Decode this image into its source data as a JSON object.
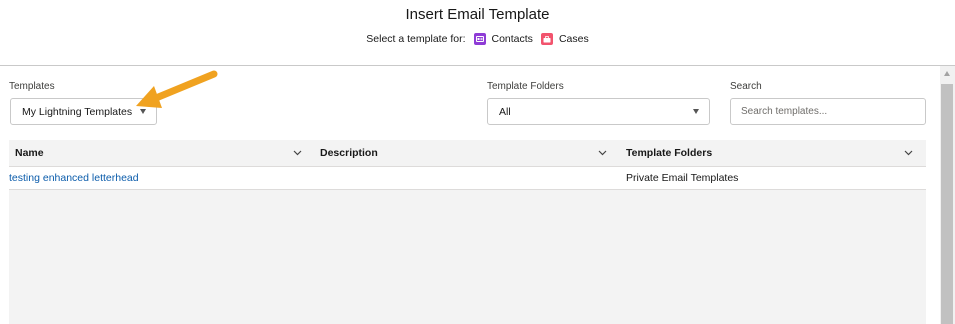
{
  "header": {
    "title": "Insert Email Template",
    "select_for_label": "Select a template for:",
    "objects": [
      {
        "label": "Contacts",
        "icon": "contact-card-icon",
        "color": "#8e3bd6"
      },
      {
        "label": "Cases",
        "icon": "case-briefcase-icon",
        "color": "#f2536d"
      }
    ]
  },
  "filters": {
    "templates": {
      "label": "Templates",
      "value": "My Lightning Templates"
    },
    "folders": {
      "label": "Template Folders",
      "value": "All"
    },
    "search": {
      "label": "Search",
      "placeholder": "Search templates..."
    }
  },
  "table": {
    "columns": [
      "Name",
      "Description",
      "Template Folders"
    ],
    "rows": [
      {
        "name": "testing enhanced letterhead",
        "description": "",
        "folder": "Private Email Templates"
      }
    ]
  },
  "annotation": {
    "type": "arrow",
    "color": "#f0a220",
    "points_to": "templates-select"
  }
}
